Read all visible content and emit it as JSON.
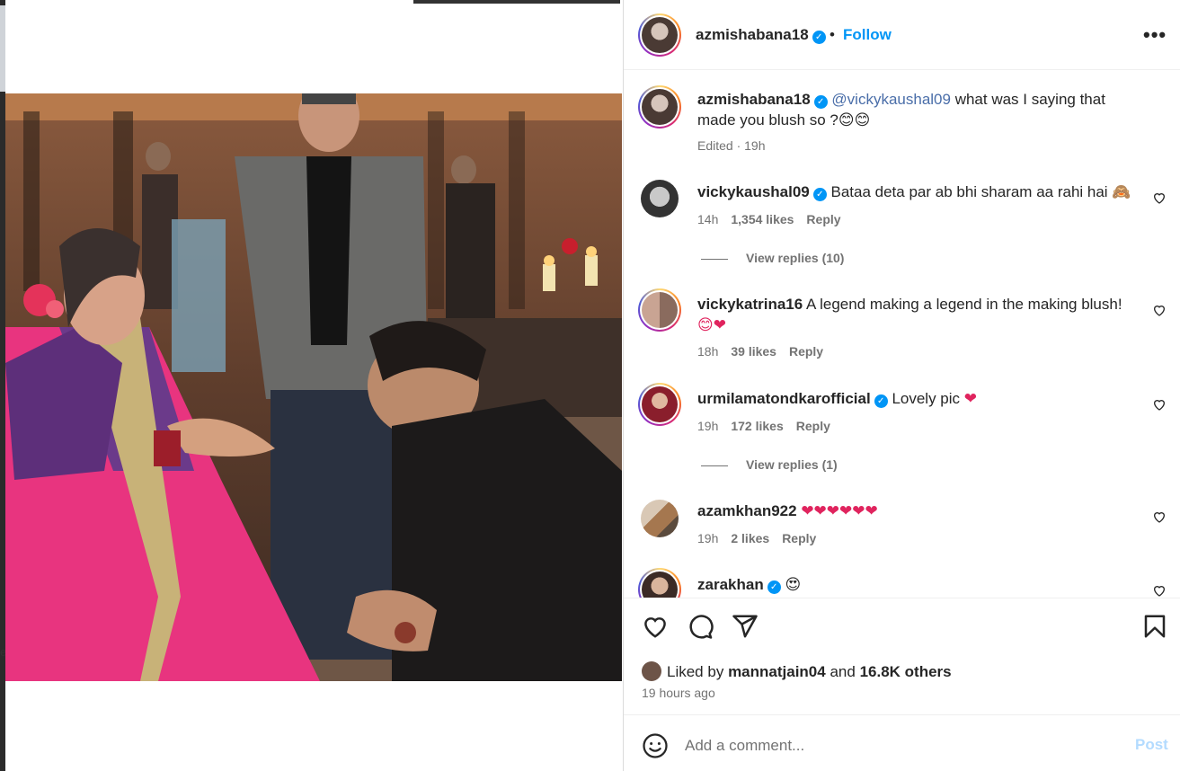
{
  "post": {
    "author": "azmishabana18",
    "follow_label": "Follow",
    "separator": "•",
    "more_label": "•••"
  },
  "caption": {
    "user": "azmishabana18",
    "mention": "@vickykaushal09",
    "text": " what was I saying that made you blush so ?",
    "emoji": "😊😊",
    "meta": "Edited · 19h"
  },
  "comments": [
    {
      "user": "vickykaushal09",
      "verified": true,
      "text": " Bataa deta par ab bhi sharam aa rahi hai ",
      "emoji": "🙈",
      "time": "14h",
      "likes": "1,354 likes",
      "reply": "Reply",
      "replies": "View replies (10)"
    },
    {
      "user": "vickykatrina16",
      "verified": false,
      "text": " A legend making a legend in the making blush!",
      "emoji": "😊❤",
      "time": "18h",
      "likes": "39 likes",
      "reply": "Reply",
      "replies": ""
    },
    {
      "user": "urmilamatondkarofficial",
      "verified": true,
      "text": " Lovely pic ",
      "emoji": "❤",
      "time": "19h",
      "likes": "172 likes",
      "reply": "Reply",
      "replies": "View replies (1)"
    },
    {
      "user": "azamkhan922",
      "verified": false,
      "text": " ",
      "emoji": "❤❤❤❤❤❤",
      "time": "19h",
      "likes": "2 likes",
      "reply": "Reply",
      "replies": ""
    },
    {
      "user": "zarakhan",
      "verified": true,
      "text": " ",
      "emoji": "😍",
      "time": "",
      "likes": "",
      "reply": "",
      "replies": ""
    }
  ],
  "engagement": {
    "liked_by_prefix": "Liked by",
    "liked_by_user": "mannatjain04",
    "and": "and",
    "others": "16.8K others",
    "time_ago": "19 hours ago"
  },
  "comment_box": {
    "placeholder": "Add a comment...",
    "post_label": "Post"
  },
  "icons": [
    "heart-icon",
    "comment-icon",
    "share-icon",
    "bookmark-icon",
    "emoji-icon",
    "verified-icon",
    "more-icon"
  ],
  "colors": {
    "accent": "#0095f6",
    "post_disabled": "#b3dbff",
    "like_red": "#ed4956"
  }
}
